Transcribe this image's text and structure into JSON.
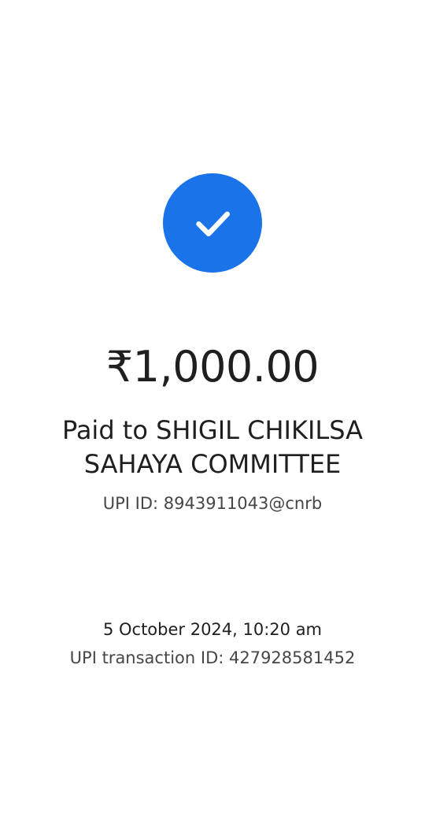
{
  "status": {
    "icon": "check-icon",
    "color": "#1a73e8"
  },
  "payment": {
    "amount": "₹1,000.00",
    "paid_to_line1": "Paid to SHIGIL CHIKILSA",
    "paid_to_line2": "SAHAYA COMMITTEE",
    "upi_id": "UPI ID: 8943911043@cnrb"
  },
  "transaction": {
    "datetime": "5 October 2024, 10:20 am",
    "transaction_id": "UPI transaction ID: 427928581452"
  }
}
